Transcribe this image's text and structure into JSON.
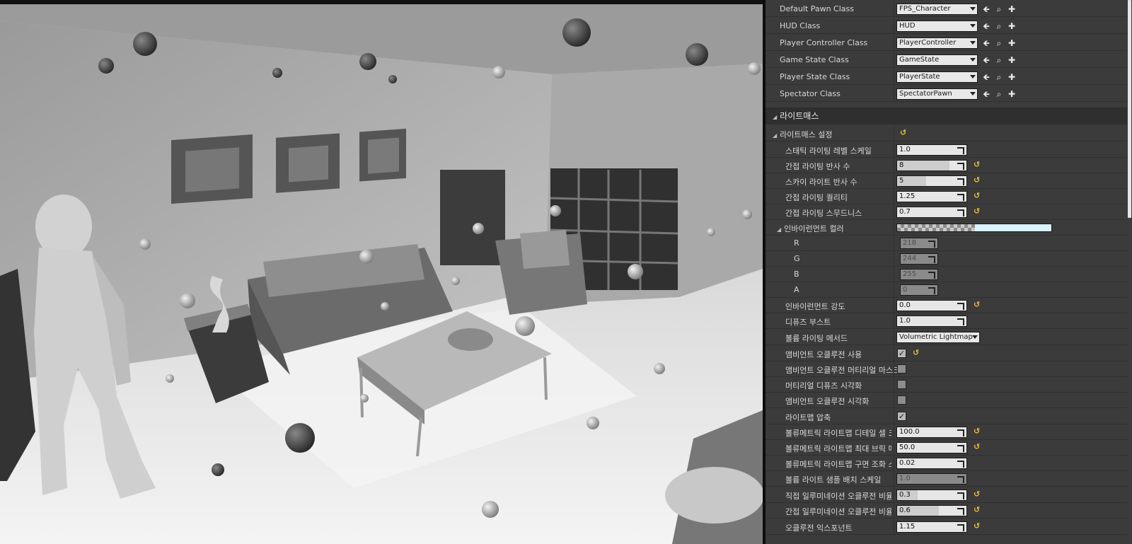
{
  "game_mode": {
    "default_pawn_class": {
      "label": "Default Pawn Class",
      "value": "FPS_Character"
    },
    "hud_class": {
      "label": "HUD Class",
      "value": "HUD"
    },
    "player_controller_class": {
      "label": "Player Controller Class",
      "value": "PlayerController"
    },
    "game_state_class": {
      "label": "Game State Class",
      "value": "GameState"
    },
    "player_state_class": {
      "label": "Player State Class",
      "value": "PlayerState"
    },
    "spectator_class": {
      "label": "Spectator Class",
      "value": "SpectatorPawn"
    }
  },
  "lightmass": {
    "category": "라이트매스",
    "settings_header": "라이트매스 설정",
    "static_lighting_level_scale": {
      "label": "스태틱 라이팅 레벨 스케일",
      "value": "1.0"
    },
    "indirect_lighting_bounces": {
      "label": "간접 라이팅 반사 수",
      "value": "8"
    },
    "skylight_bounces": {
      "label": "스카이 라이트 반사 수",
      "value": "5"
    },
    "indirect_lighting_quality": {
      "label": "간접 라이팅 퀄리티",
      "value": "1.25"
    },
    "indirect_lighting_smoothness": {
      "label": "간접 라이팅 스무드니스",
      "value": "0.7"
    },
    "environment_color": {
      "label": "인바이런먼트 컬러",
      "swatch_color": "#daf4ff",
      "r": {
        "label": "R",
        "value": "218"
      },
      "g": {
        "label": "G",
        "value": "244"
      },
      "b": {
        "label": "B",
        "value": "255"
      },
      "a": {
        "label": "A",
        "value": "0"
      }
    },
    "environment_intensity": {
      "label": "인바이런먼트 강도",
      "value": "0.0"
    },
    "diffuse_boost": {
      "label": "디퓨즈 부스트",
      "value": "1.0"
    },
    "volume_lighting_method": {
      "label": "볼륨 라이팅 메서드",
      "value": "Volumetric Lightmap"
    },
    "use_ambient_occlusion": {
      "label": "앰비언트 오클루전 사용",
      "checked": true
    },
    "ao_material_mask": {
      "label": "앰비언트 오클루전 머티리얼 마스크",
      "checked": false
    },
    "visualize_material_diffuse": {
      "label": "머티리얼 디퓨즈 시각화",
      "checked": false
    },
    "visualize_ao": {
      "label": "앰비언트 오클루전 시각화",
      "checked": false
    },
    "compress_lightmaps": {
      "label": "라이트맵 압축",
      "checked": true
    },
    "vlm_detail_cell_size": {
      "label": "볼류메트릭 라이트맵 디테일 셀 크기",
      "value": "100.0"
    },
    "vlm_max_brick_memory": {
      "label": "볼류메트릭 라이트맵 최대 브릭 메모리",
      "value": "50.0"
    },
    "vlm_sh_ringing": {
      "label": "볼류메트릭 라이트맵 구면 조화 스무딩",
      "value": "0.02"
    },
    "volume_light_sample_scale": {
      "label": "볼륨 라이트 샘플 배치 스케일",
      "value": "1.0"
    },
    "direct_illum_occlusion_fraction": {
      "label": "직접 일루미네이션 오클루전 비율",
      "value": "0.3"
    },
    "indirect_illum_occlusion_fraction": {
      "label": "간접 일루미네이션 오클루전 비율",
      "value": "0.6"
    },
    "occlusion_exponent": {
      "label": "오클루전 익스포넌트",
      "value": "1.15"
    }
  },
  "icons": {
    "use_selected": "arrow-left-icon",
    "browse": "magnifier-icon",
    "add": "plus-icon",
    "reset": "reset-to-default-icon"
  }
}
